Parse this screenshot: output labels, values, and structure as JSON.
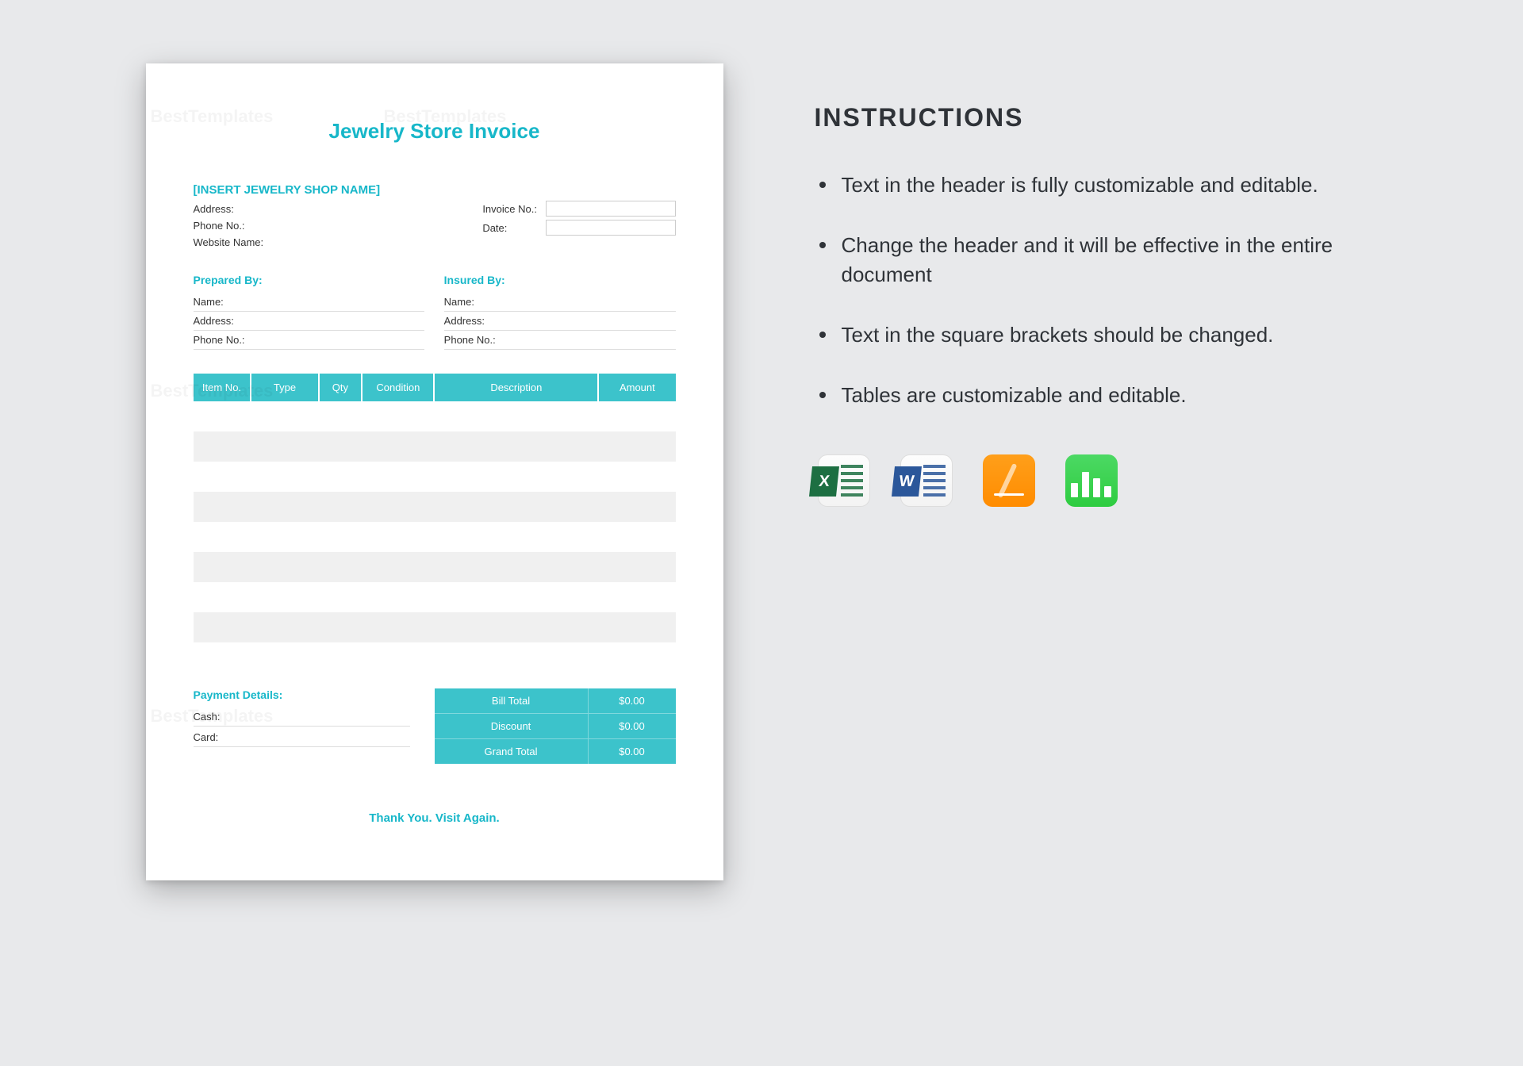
{
  "invoice": {
    "title": "Jewelry Store Invoice",
    "shop_name": "[INSERT JEWELRY SHOP NAME]",
    "address_label": "Address:",
    "phone_label": "Phone No.:",
    "website_label": "Website Name:",
    "invoice_no_label": "Invoice No.:",
    "date_label": "Date:",
    "prepared_by": "Prepared By:",
    "insured_by": "Insured By:",
    "name_label": "Name:",
    "address2_label": "Address:",
    "phone2_label": "Phone No.:",
    "table": {
      "headers": [
        "Item No.",
        "Type",
        "Qty",
        "Condition",
        "Description",
        "Amount"
      ]
    },
    "payment_details": "Payment Details:",
    "cash_label": "Cash:",
    "card_label": "Card:",
    "totals": {
      "bill_total_label": "Bill Total",
      "bill_total_value": "$0.00",
      "discount_label": "Discount",
      "discount_value": "$0.00",
      "grand_total_label": "Grand Total",
      "grand_total_value": "$0.00"
    },
    "thanks": "Thank You. Visit Again."
  },
  "side": {
    "heading": "INSTRUCTIONS",
    "bullets": [
      "Text in the header is fully customizable and editable.",
      "Change the header and it will be effective in the entire document",
      "Text in the square brackets should be changed.",
      "Tables are customizable and editable."
    ],
    "icons": {
      "excel": "X",
      "word": "W"
    }
  },
  "watermark": "BestTemplates"
}
